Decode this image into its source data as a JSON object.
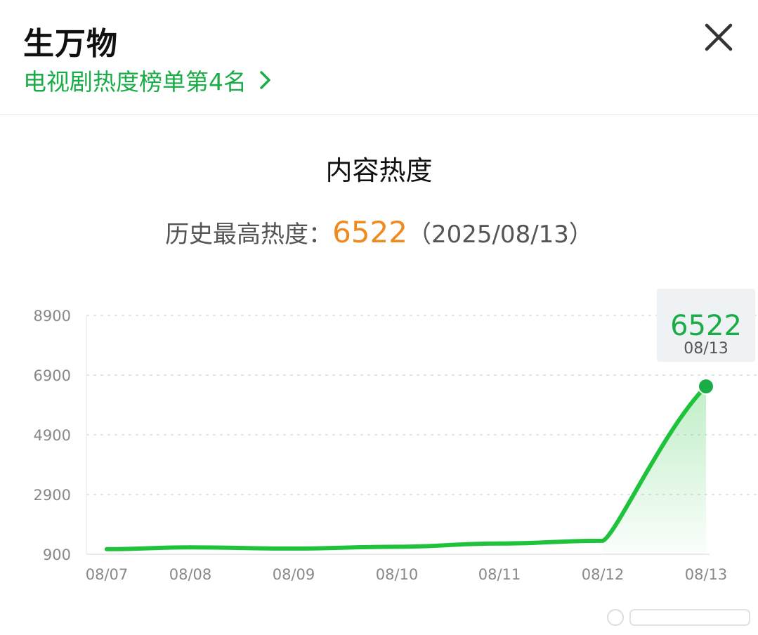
{
  "header": {
    "title": "生万物",
    "rank_text": "电视剧热度榜单第4名"
  },
  "section_title": "内容热度",
  "peak": {
    "label": "历史最高热度：",
    "value": "6522",
    "date": "（2025/08/13）"
  },
  "colors": {
    "accent": "#1aad47",
    "line": "#1ec33b",
    "peak": "#f08a1c"
  },
  "chart_data": {
    "type": "line",
    "title": "内容热度",
    "x": [
      "08/07",
      "08/08",
      "08/09",
      "08/10",
      "08/11",
      "08/12",
      "08/13"
    ],
    "y_ticks": [
      "8900",
      "6900",
      "4900",
      "2900",
      "900"
    ],
    "ylim": [
      900,
      8900
    ],
    "grid": true,
    "series": [
      {
        "values": [
          1070,
          1130,
          1090,
          1150,
          1260,
          1350,
          6522
        ]
      }
    ],
    "tooltip": {
      "value": "6522",
      "date": "08/13"
    }
  }
}
